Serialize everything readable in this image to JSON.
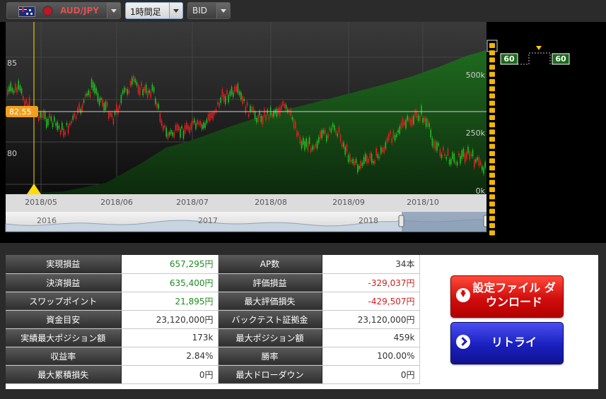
{
  "toolbar": {
    "pair": "AUD/JPY",
    "timeframe": "1時間足",
    "price_type": "BID"
  },
  "chart": {
    "price_labels": [
      "85",
      "80"
    ],
    "current_price": "82.55",
    "position_labels": [
      "500k",
      "250k",
      "0k"
    ],
    "x_labels": [
      "2018/05",
      "2018/06",
      "2018/07",
      "2018/08",
      "2018/09",
      "2018/10"
    ],
    "navigator_labels": [
      "2016",
      "2017",
      "2018"
    ],
    "marker_values": [
      "60",
      "60"
    ],
    "colors": {
      "up": "#22bb22",
      "down": "#e02020",
      "position_fill": "#1e5a1e",
      "cursor": "#ffdd00",
      "price_badge": "#f0a020"
    }
  },
  "results": {
    "rows": [
      {
        "l1": "実現損益",
        "v1": "657,295円",
        "l2": "AP数",
        "v2": "34本"
      },
      {
        "l1": "決済損益",
        "v1": "635,400円",
        "l2": "評価損益",
        "v2": "-329,037円"
      },
      {
        "l1": "スワップポイント",
        "v1": "21,895円",
        "l2": "最大評価損失",
        "v2": "-429,507円"
      },
      {
        "l1": "資金目安",
        "v1": "23,120,000円",
        "l2": "バックテスト証拠金",
        "v2": "23,120,000円"
      },
      {
        "l1": "実績最大ポジション額",
        "v1": "173k",
        "l2": "最大ポジション額",
        "v2": "459k"
      },
      {
        "l1": "収益率",
        "v1": "2.84%",
        "l2": "勝率",
        "v2": "100.00%"
      },
      {
        "l1": "最大累積損失",
        "v1": "0円",
        "l2": "最大ドローダウン",
        "v2": "0円"
      }
    ],
    "buttons": {
      "download": "設定ファイル ダウンロード",
      "retry": "リトライ"
    }
  }
}
